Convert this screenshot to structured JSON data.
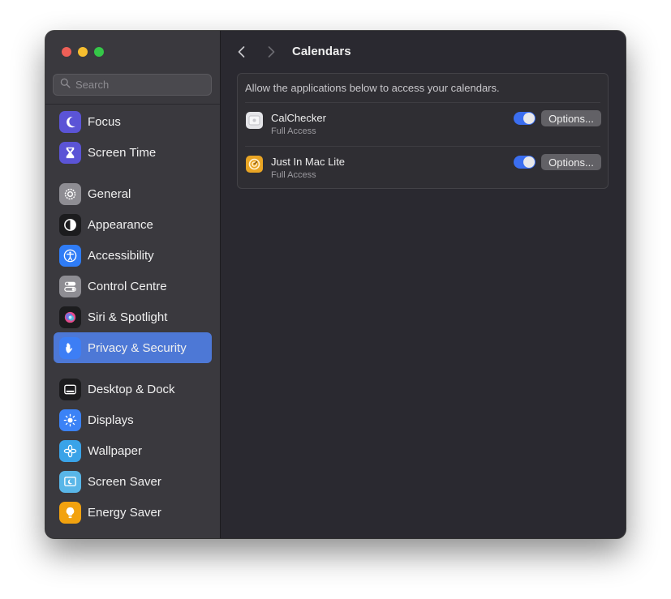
{
  "search": {
    "placeholder": "Search"
  },
  "sidebar": {
    "groups": [
      [
        {
          "label": "Focus",
          "icon": "moon-icon",
          "color": "#5b54d6"
        },
        {
          "label": "Screen Time",
          "icon": "hourglass-icon",
          "color": "#5b54d6"
        }
      ],
      [
        {
          "label": "General",
          "icon": "gear-icon",
          "color": "#8e8d93"
        },
        {
          "label": "Appearance",
          "icon": "appearance-icon",
          "color": "#1c1c1e"
        },
        {
          "label": "Accessibility",
          "icon": "accessibility-icon",
          "color": "#2f7cf6"
        },
        {
          "label": "Control Centre",
          "icon": "switches-icon",
          "color": "#8e8d93"
        },
        {
          "label": "Siri & Spotlight",
          "icon": "siri-icon",
          "color": "#1c1c1e"
        },
        {
          "label": "Privacy & Security",
          "icon": "hand-icon",
          "color": "#3d7ef5",
          "active": true
        }
      ],
      [
        {
          "label": "Desktop & Dock",
          "icon": "dock-icon",
          "color": "#1c1c1e"
        },
        {
          "label": "Displays",
          "icon": "sun-icon",
          "color": "#3b82f6"
        },
        {
          "label": "Wallpaper",
          "icon": "flower-icon",
          "color": "#3aa3e8"
        },
        {
          "label": "Screen Saver",
          "icon": "screensaver-icon",
          "color": "#59b6e8"
        },
        {
          "label": "Energy Saver",
          "icon": "lightbulb-icon",
          "color": "#f2a20f"
        }
      ]
    ]
  },
  "main": {
    "title": "Calendars",
    "description": "Allow the applications below to access your calendars.",
    "apps": [
      {
        "name": "CalChecker",
        "access": "Full Access",
        "enabled": true,
        "options_label": "Options...",
        "icon": "calchecker-icon"
      },
      {
        "name": "Just In Mac Lite",
        "access": "Full Access",
        "enabled": true,
        "options_label": "Options...",
        "icon": "justinmac-icon"
      }
    ]
  }
}
